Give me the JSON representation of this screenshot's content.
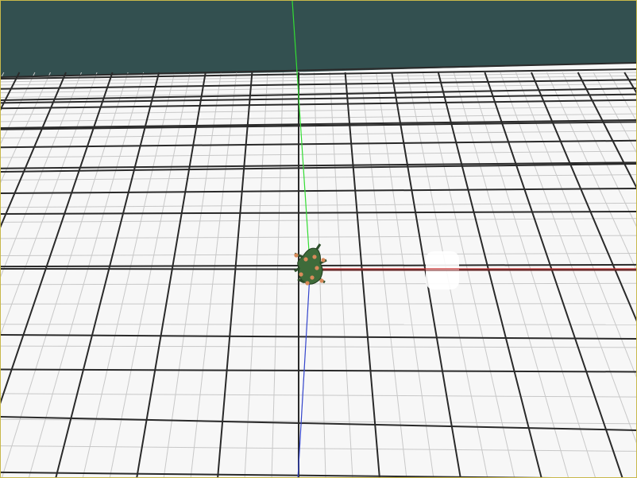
{
  "viewport": {
    "sky_color": "#335050",
    "floor_color": "#f7f7f7",
    "minor_grid_color": "#c8c8c8",
    "major_grid_color": "#2a2a2a",
    "border_color": "#c8b84a"
  },
  "axes": {
    "x_color": "#cc3333",
    "y_color": "#33dd33",
    "z_color": "#3344cc"
  },
  "robot": {
    "body_color": "#3e6b3a",
    "joint_color": "#d98a5a"
  },
  "highlight": {
    "color": "#ffffff"
  }
}
